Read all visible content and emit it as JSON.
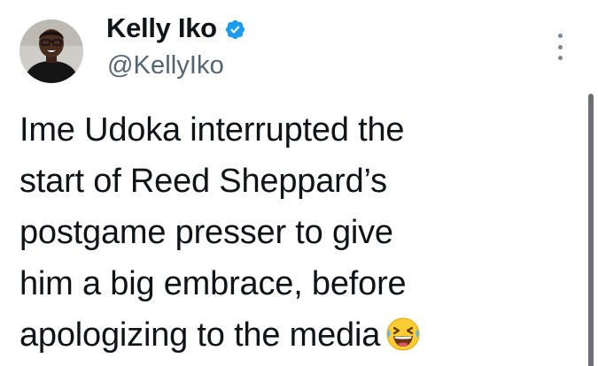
{
  "author": {
    "display_name": "Kelly Iko",
    "handle": "@KellyIko",
    "verified": true,
    "verified_color": "#1d9bf0"
  },
  "tweet": {
    "lines": [
      "Ime Udoka interrupted the",
      "start of Reed Sheppard’s",
      "postgame presser to give",
      "him a big embrace, before",
      "apologizing to the media"
    ],
    "trailing_emoji": "grinning-squinting-sweat-emoji"
  },
  "icons": {
    "more": "more-vertical-icon",
    "verified": "verified-badge-icon"
  },
  "colors": {
    "text": "#0f1419",
    "secondary": "#536471"
  }
}
